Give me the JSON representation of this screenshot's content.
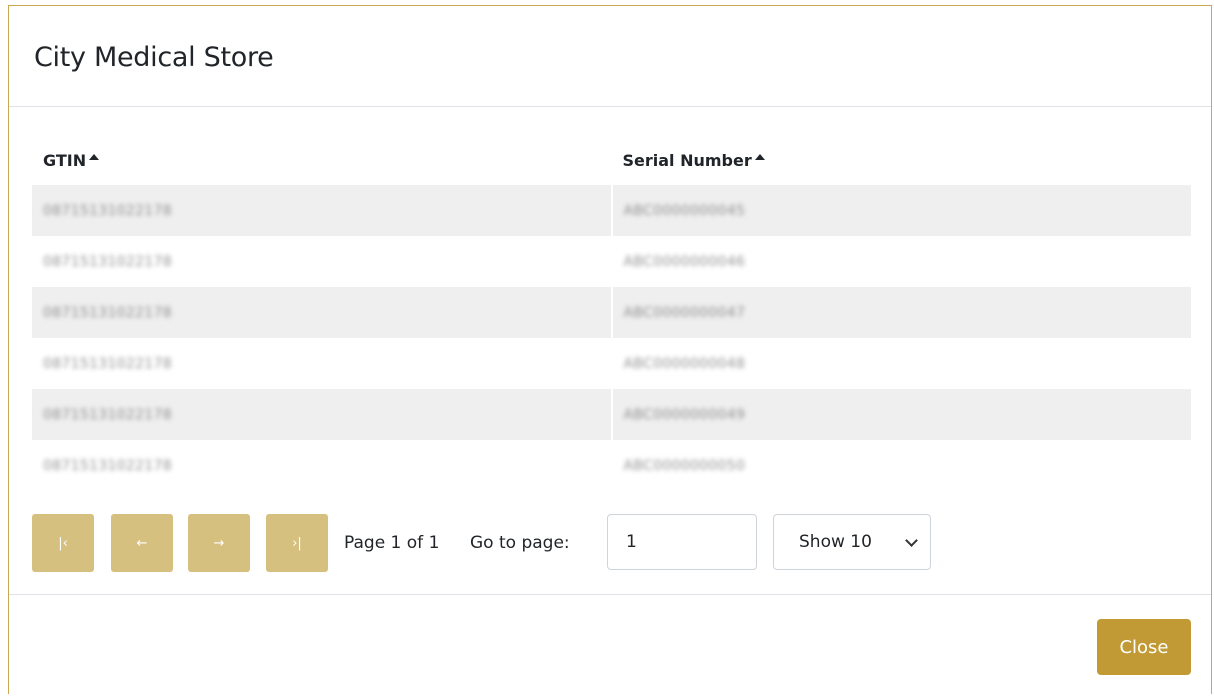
{
  "modal": {
    "title": "City Medical Store"
  },
  "table": {
    "columns": [
      "GTIN",
      "Serial Number"
    ],
    "rows": [
      {
        "gtin": "08715131022178",
        "serial": "ABC0000000045"
      },
      {
        "gtin": "08715131022178",
        "serial": "ABC0000000046"
      },
      {
        "gtin": "08715131022178",
        "serial": "ABC0000000047"
      },
      {
        "gtin": "08715131022178",
        "serial": "ABC0000000048"
      },
      {
        "gtin": "08715131022178",
        "serial": "ABC0000000049"
      },
      {
        "gtin": "08715131022178",
        "serial": "ABC0000000050"
      }
    ]
  },
  "pagination": {
    "first_icon": "first-page-icon",
    "prev_icon": "arrow-left-icon",
    "next_icon": "arrow-right-icon",
    "last_icon": "last-page-icon",
    "first_glyph": "|‹",
    "prev_glyph": "←",
    "next_glyph": "→",
    "last_glyph": "›|",
    "page_info": "Page 1 of 1",
    "goto_label": "Go to page:",
    "goto_value": "1",
    "show_selected": "Show 10"
  },
  "footer": {
    "close_label": "Close"
  },
  "colors": {
    "pager_button": "#d6c07f",
    "primary_button": "#c19a35",
    "border_accent": "#c9a84f",
    "row_stripe": "#efefef"
  }
}
